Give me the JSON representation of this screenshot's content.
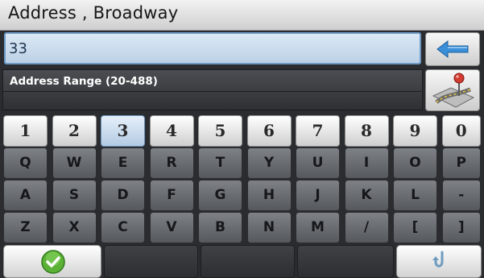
{
  "title": "Address , Broadway",
  "entry": {
    "value": "33"
  },
  "info": {
    "range_text": "Address Range (20-488)"
  },
  "keyboard": {
    "number_row": [
      "1",
      "2",
      "3",
      "4",
      "5",
      "6",
      "7",
      "8",
      "9",
      "0"
    ],
    "selected_key": "3",
    "row_1": [
      "Q",
      "W",
      "E",
      "R",
      "T",
      "Y",
      "U",
      "I",
      "O",
      "P"
    ],
    "row_2": [
      "A",
      "S",
      "D",
      "F",
      "G",
      "H",
      "J",
      "K",
      "L",
      "-"
    ],
    "row_3": [
      "Z",
      "X",
      "C",
      "V",
      "B",
      "N",
      "M",
      "/",
      "[",
      "]"
    ]
  },
  "icons": {
    "backspace": "back-arrow-icon",
    "map": "map-pin-road-icon",
    "ok": "checkmark-icon",
    "undo": "undo-icon"
  },
  "colors": {
    "selected_key": "#b3cbe3",
    "input_bg": "#c9dcee",
    "arrow_blue": "#3a8fd8",
    "ok_green": "#5bb236"
  }
}
